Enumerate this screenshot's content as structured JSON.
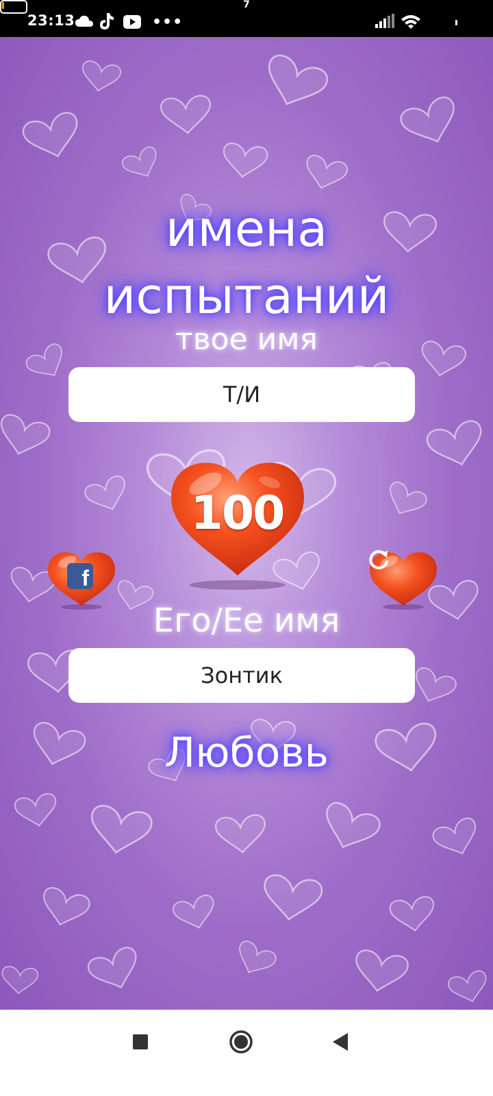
{
  "status_bar": {
    "time": "23:13",
    "battery_level": "7",
    "icons": [
      "cloud-icon",
      "tiktok-icon",
      "youtube-icon",
      "more-icon",
      "signal-icon",
      "wifi-icon",
      "battery-icon"
    ],
    "more": "•••"
  },
  "app": {
    "title_line1": "имена",
    "title_line2": "испытаний",
    "your_name_label": "твое имя",
    "your_name_value": "Т/И",
    "score": "100",
    "their_name_label": "Его/Ее имя",
    "their_name_value": "Зонтик",
    "result": "Любовь",
    "facebook_badge": "f",
    "colors": {
      "background": "#a273cf",
      "heart": "#f04a1e",
      "title_glow": "#5f50ff",
      "facebook": "#3b5998"
    }
  },
  "nav_bar": {
    "icons": [
      "recents-icon",
      "home-icon",
      "back-icon"
    ]
  }
}
